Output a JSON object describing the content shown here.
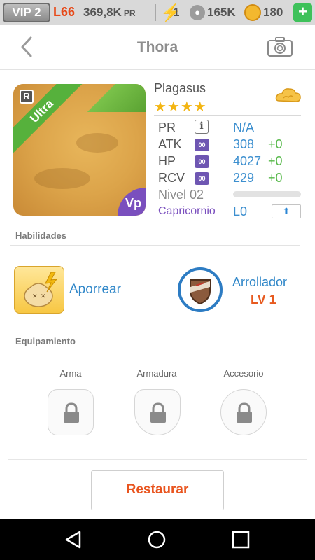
{
  "status_bar": {
    "vip": "VIP 2",
    "level": "L66",
    "power": "369,8K",
    "power_unit": "PR",
    "energy": "1",
    "paw_points": "165K",
    "coins": "180",
    "add_label": "+"
  },
  "nav": {
    "title": "Thora",
    "back_icon": "chevron-left-icon",
    "camera_icon": "camera-icon"
  },
  "pet": {
    "rarity_badge": "R",
    "ribbon": "Ultra",
    "corner_badge": "Vp",
    "name": "Plagasus",
    "stars": "★★★★",
    "star_count": 4,
    "element_icon": "cloud-icon",
    "stats": [
      {
        "label": "PR",
        "icon": "info-icon",
        "icon_text": "i",
        "value": "N/A",
        "bonus": ""
      },
      {
        "label": "ATK",
        "icon": "stat-gem-icon",
        "icon_text": "00",
        "value": "308",
        "bonus": "+0"
      },
      {
        "label": "HP",
        "icon": "stat-gem-icon",
        "icon_text": "00",
        "value": "4027",
        "bonus": "+0"
      },
      {
        "label": "RCV",
        "icon": "stat-gem-icon",
        "icon_text": "00",
        "value": "229",
        "bonus": "+0"
      }
    ],
    "level_label": "Nivel 02",
    "level_progress": 0.0,
    "sign": "Capricornio",
    "sign_level": "L0"
  },
  "skills": {
    "title": "Habilidades",
    "active": {
      "name": "Aporrear",
      "icon": "dumpling-skill-icon"
    },
    "passive": {
      "name": "Arrollador",
      "level": "LV 1",
      "icon": "shield-skill-icon"
    }
  },
  "equipment": {
    "title": "Equipamiento",
    "slots": [
      {
        "label": "Arma",
        "icon": "lock-icon"
      },
      {
        "label": "Armadura",
        "icon": "lock-icon"
      },
      {
        "label": "Accesorio",
        "icon": "lock-icon"
      }
    ]
  },
  "actions": {
    "restore_label": "Restaurar"
  },
  "colors": {
    "accent_blue": "#2e86c8",
    "accent_orange": "#e9541e",
    "green": "#57b94a",
    "purple": "#7a4fbe"
  }
}
